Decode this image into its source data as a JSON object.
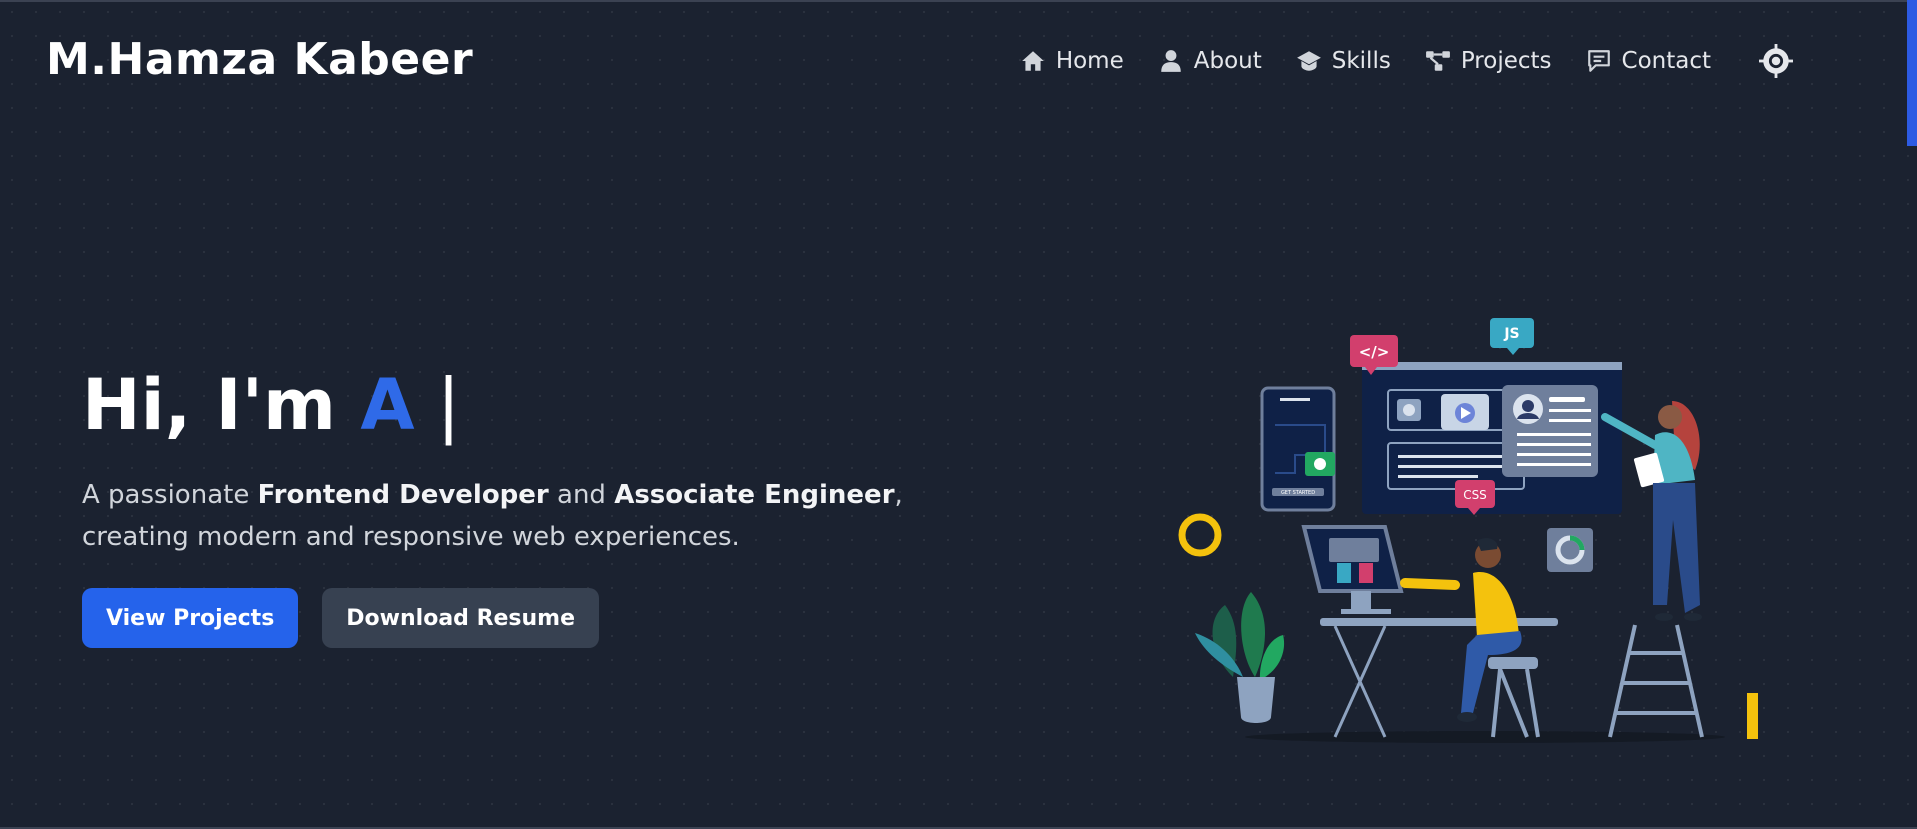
{
  "header": {
    "logo": "M.Hamza Kabeer",
    "nav": [
      {
        "label": "Home",
        "icon": "home-icon"
      },
      {
        "label": "About",
        "icon": "user-icon"
      },
      {
        "label": "Skills",
        "icon": "graduation-cap-icon"
      },
      {
        "label": "Projects",
        "icon": "project-diagram-icon"
      },
      {
        "label": "Contact",
        "icon": "message-icon"
      }
    ],
    "theme_toggle_icon": "sun-icon"
  },
  "hero": {
    "greeting": "Hi, I'm ",
    "typed_text": "A",
    "cursor": " |",
    "desc_intro": "A passionate ",
    "desc_role_1": "Frontend Developer",
    "desc_and": " and ",
    "desc_role_2": "Associate Engineer",
    "desc_outro": ", creating modern and responsive web experiences.",
    "primary_button": "View Projects",
    "secondary_button": "Download Resume"
  },
  "illustration": {
    "code_tag": "</>",
    "js_tag": "JS",
    "css_tag": "CSS",
    "phone_button": "GET STARTED"
  },
  "colors": {
    "background": "#1b2230",
    "accent": "#2563eb",
    "typed_accent": "#2f6ae8",
    "secondary_button": "#374151"
  }
}
